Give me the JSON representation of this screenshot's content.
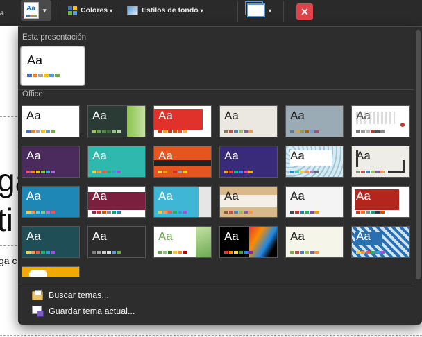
{
  "toolbar": {
    "left_cut_text": "a",
    "colors_label": "Colores",
    "bg_styles_label": "Estilos de fondo",
    "dropdown_caret": "▾",
    "close_glyph": "✕",
    "accent_red": "#e0424b"
  },
  "background_doc": {
    "big_line_1": "ga",
    "big_line_2": "ti",
    "small_text": "ga c"
  },
  "gallery": {
    "section_presentation": "Esta presentación",
    "section_office": "Office",
    "presentation_theme": {
      "aa": "Aa",
      "swatches": [
        "#4472c4",
        "#ed7d31",
        "#a5a5a5",
        "#ffc000",
        "#5b9bd5",
        "#70ad47"
      ]
    },
    "themes": [
      {
        "aa": "Aa",
        "bg": "#ffffff",
        "fg": "#111111",
        "deco": "none",
        "swatches": [
          "#4472c4",
          "#ed7d31",
          "#a5a5a5",
          "#ffc000",
          "#5b9bd5",
          "#70ad47"
        ]
      },
      {
        "aa": "Aa",
        "bg": "#2a3b35",
        "fg": "#ffffff",
        "deco": "green-right",
        "swatches": [
          "#a5c249",
          "#6aa84f",
          "#4e8b3a",
          "#3d7030",
          "#93c47d",
          "#b6d7a8"
        ]
      },
      {
        "aa": "Aa",
        "bg": "#ffffff",
        "fg": "#ffffff",
        "deco": "red-block",
        "swatches": [
          "#e0312a",
          "#f39c12",
          "#c0392b",
          "#d35400",
          "#e74c3c",
          "#f5b041"
        ]
      },
      {
        "aa": "Aa",
        "bg": "#ebe7e1",
        "fg": "#222222",
        "deco": "none",
        "swatches": [
          "#8b7355",
          "#c0504d",
          "#4f81bd",
          "#9bbb59",
          "#8064a2",
          "#f79646"
        ]
      },
      {
        "aa": "Aa",
        "bg": "#9aabb6",
        "fg": "#222222",
        "deco": "none",
        "swatches": [
          "#5f7a8a",
          "#d9a441",
          "#8a9a5b",
          "#b45f06",
          "#6d9eeb",
          "#a64d79"
        ]
      },
      {
        "aa": "Aa",
        "bg": "#ffffff",
        "fg": "#555555",
        "deco": "dots",
        "swatches": [
          "#777777",
          "#999999",
          "#bbbbbb",
          "#c0392b",
          "#555555",
          "#888888"
        ]
      },
      {
        "aa": "Aa",
        "bg": "#4b2a5e",
        "fg": "#ffffff",
        "deco": "none",
        "swatches": [
          "#e64a7b",
          "#f08a24",
          "#d4c11f",
          "#8bc34a",
          "#3fa7d6",
          "#a06cd5"
        ]
      },
      {
        "aa": "Aa",
        "bg": "#2fb8ad",
        "fg": "#ffffff",
        "deco": "none",
        "swatches": [
          "#f2c94c",
          "#f2994a",
          "#eb5757",
          "#27ae60",
          "#2d9cdb",
          "#9b51e0"
        ]
      },
      {
        "aa": "Aa",
        "bg": "#e4551f",
        "fg": "#ffffff",
        "deco": "dark-band",
        "swatches": [
          "#fbd34d",
          "#f59e0b",
          "#ea580c",
          "#dc2626",
          "#a3a3a3",
          "#facc15"
        ]
      },
      {
        "aa": "Aa",
        "bg": "#3a2a7a",
        "fg": "#ffffff",
        "deco": "none",
        "swatches": [
          "#f59e0b",
          "#ef4444",
          "#10b981",
          "#3b82f6",
          "#ec4899",
          "#eab308"
        ]
      },
      {
        "aa": "Aa",
        "bg": "#bcdce8",
        "fg": "#222222",
        "deco": "pattern",
        "swatches": [
          "#2e86c1",
          "#48c9b0",
          "#f4d03f",
          "#eb984e",
          "#af7ac5",
          "#5d6d7e"
        ]
      },
      {
        "aa": "Aa",
        "bg": "#efede8",
        "fg": "#222222",
        "deco": "frame",
        "swatches": [
          "#8b8b7a",
          "#c0504d",
          "#4f81bd",
          "#9bbb59",
          "#8064a2",
          "#f79646"
        ]
      },
      {
        "aa": "Aa",
        "bg": "#1e87b5",
        "fg": "#ffffff",
        "deco": "none",
        "swatches": [
          "#f2c94c",
          "#f2994a",
          "#56ccf2",
          "#6fcf97",
          "#bb6bd9",
          "#eb5757"
        ]
      },
      {
        "aa": "Aa",
        "bg": "#ffffff",
        "fg": "#ffffff",
        "deco": "maroon-block",
        "swatches": [
          "#8e2748",
          "#c0392b",
          "#d35400",
          "#7f8c8d",
          "#16a085",
          "#2980b9"
        ]
      },
      {
        "aa": "Aa",
        "bg": "#3fb6d6",
        "fg": "#ffffff",
        "deco": "grey-right",
        "swatches": [
          "#f2c94c",
          "#f2994a",
          "#eb5757",
          "#27ae60",
          "#2d9cdb",
          "#9b51e0"
        ]
      },
      {
        "aa": "Aa",
        "bg": "#d9b88a",
        "fg": "#222222",
        "deco": "white-band",
        "swatches": [
          "#8b5e34",
          "#c0504d",
          "#4f81bd",
          "#9bbb59",
          "#8064a2",
          "#f79646"
        ]
      },
      {
        "aa": "Aa",
        "bg": "#f4f4f4",
        "fg": "#222222",
        "deco": "none",
        "swatches": [
          "#444444",
          "#c0392b",
          "#2980b9",
          "#27ae60",
          "#8e44ad",
          "#f39c12"
        ]
      },
      {
        "aa": "Aa",
        "bg": "#ffffff",
        "fg": "#ffffff",
        "deco": "red-card",
        "swatches": [
          "#c0392b",
          "#e67e22",
          "#7f8c8d",
          "#16a085",
          "#2c3e50",
          "#d35400"
        ]
      },
      {
        "aa": "Aa",
        "bg": "#1f4e56",
        "fg": "#ffffff",
        "deco": "none",
        "swatches": [
          "#f2c94c",
          "#f2994a",
          "#eb5757",
          "#27ae60",
          "#2d9cdb",
          "#9b51e0"
        ]
      },
      {
        "aa": "Aa",
        "bg": "#2b2b2b",
        "fg": "#ffffff",
        "deco": "none",
        "swatches": [
          "#7f7f7f",
          "#a5a5a5",
          "#c9c9c9",
          "#e0e0e0",
          "#5b9bd5",
          "#70ad47"
        ]
      },
      {
        "aa": "Aa",
        "bg": "#ffffff",
        "fg": "#6aa84f",
        "deco": "green-right2",
        "swatches": [
          "#6aa84f",
          "#93c47d",
          "#38761d",
          "#f1c232",
          "#e69138",
          "#cc0000"
        ]
      },
      {
        "aa": "Aa",
        "bg": "#000000",
        "fg": "#ffffff",
        "deco": "rainbow",
        "swatches": [
          "#e53935",
          "#fb8c00",
          "#fdd835",
          "#43a047",
          "#1e88e5",
          "#8e24aa"
        ]
      },
      {
        "aa": "Aa",
        "bg": "#f6f5ea",
        "fg": "#222222",
        "deco": "none",
        "swatches": [
          "#8aa64d",
          "#c0504d",
          "#4f81bd",
          "#9bbb59",
          "#8064a2",
          "#f79646"
        ]
      },
      {
        "aa": "Aa",
        "bg": "#2a6fb0",
        "fg": "#ffffff",
        "deco": "blue-pattern",
        "swatches": [
          "#f2c94c",
          "#f2994a",
          "#eb5757",
          "#27ae60",
          "#2d9cdb",
          "#9b51e0"
        ]
      },
      {
        "aa": "",
        "bg": "#f2a900",
        "fg": "#ffffff",
        "deco": "cloud",
        "swatches": []
      }
    ]
  },
  "footer": {
    "browse_label": "Buscar temas...",
    "save_label": "Guardar tema actual..."
  }
}
